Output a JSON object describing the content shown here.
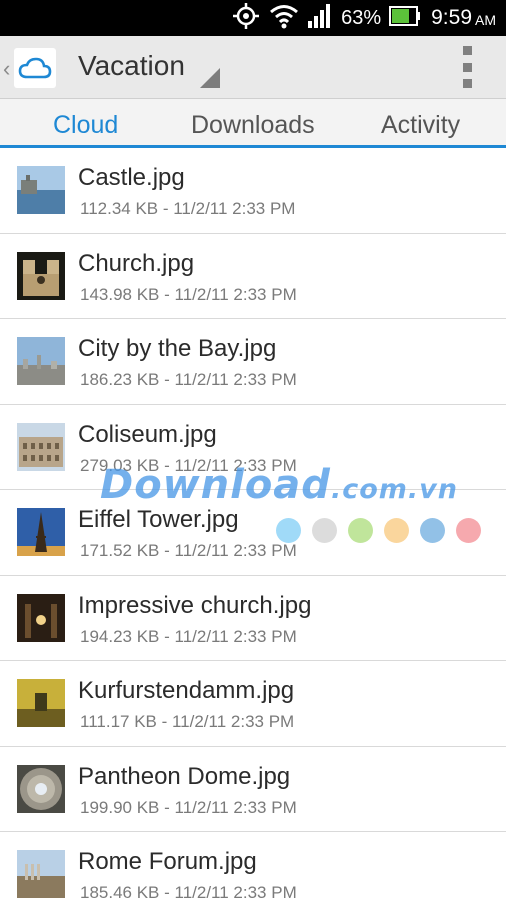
{
  "status_bar": {
    "battery_percent": "63%",
    "time": "9:59",
    "ampm": "AM",
    "icons": [
      "gps-icon",
      "wifi-icon",
      "signal-icon",
      "battery-icon"
    ]
  },
  "action_bar": {
    "title": "Vacation",
    "app_icon": "cloud-icon",
    "menu_icon": "overflow-menu-icon"
  },
  "tabs": [
    {
      "label": "Cloud",
      "active": true
    },
    {
      "label": "Downloads",
      "active": false
    },
    {
      "label": "Activity",
      "active": false
    }
  ],
  "files": [
    {
      "name": "Castle.jpg",
      "meta": "112.34 KB - 11/2/11 2:33 PM"
    },
    {
      "name": "Church.jpg",
      "meta": "143.98 KB - 11/2/11 2:33 PM"
    },
    {
      "name": "City by the Bay.jpg",
      "meta": "186.23 KB - 11/2/11 2:33 PM"
    },
    {
      "name": "Coliseum.jpg",
      "meta": "279.03 KB - 11/2/11 2:33 PM"
    },
    {
      "name": "Eiffel Tower.jpg",
      "meta": "171.52 KB - 11/2/11 2:33 PM"
    },
    {
      "name": "Impressive church.jpg",
      "meta": "194.23 KB - 11/2/11 2:33 PM"
    },
    {
      "name": "Kurfurstendamm.jpg",
      "meta": "111.17 KB - 11/2/11 2:33 PM"
    },
    {
      "name": "Pantheon Dome.jpg",
      "meta": "199.90 KB - 11/2/11 2:33 PM"
    },
    {
      "name": "Rome Forum.jpg",
      "meta": "185.46 KB - 11/2/11 2:33 PM"
    }
  ],
  "watermark": {
    "main": "Download",
    "suffix": ".com.vn",
    "dot_colors": [
      "#8fd3f7",
      "#d6d6d6",
      "#b5e08a",
      "#f9cf8c",
      "#7fb6e3",
      "#f59aa0"
    ]
  },
  "colors": {
    "accent": "#1e88d4",
    "status_bar": "#000000",
    "action_bar": "#e9e9e9"
  }
}
